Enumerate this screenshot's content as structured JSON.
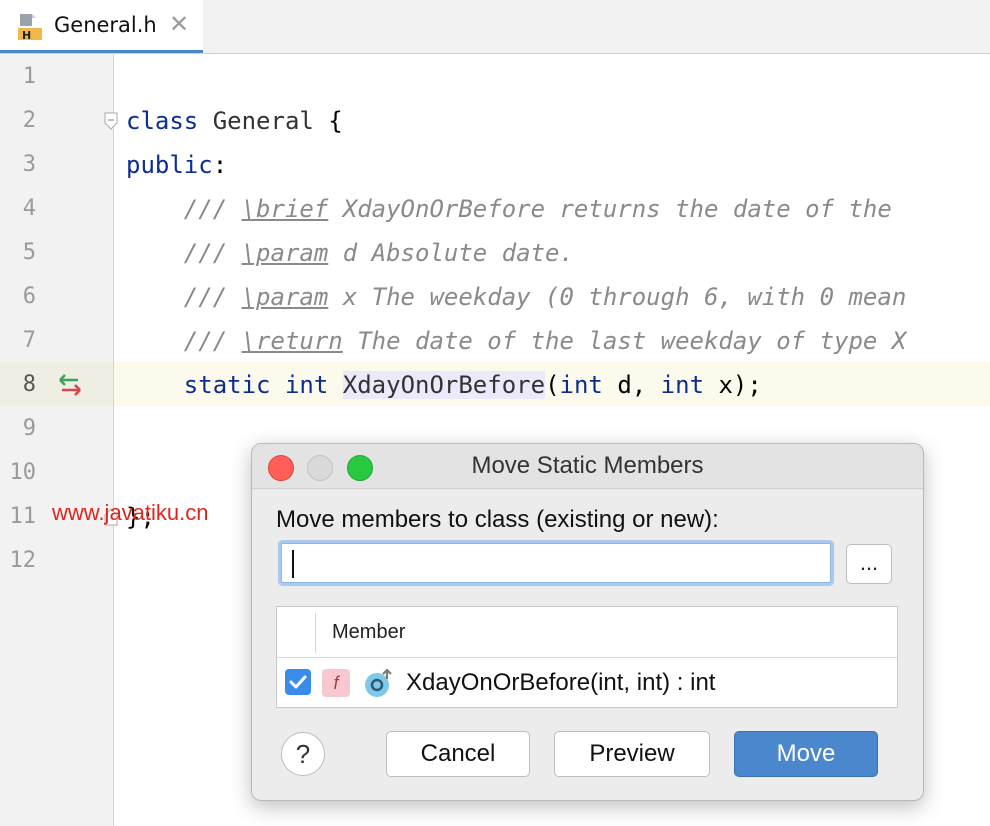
{
  "editor": {
    "tab": {
      "title": "General.h",
      "icon": "h-header-file-icon",
      "close_glyph": "✕"
    },
    "line_numbers": [
      "1",
      "2",
      "3",
      "4",
      "5",
      "6",
      "7",
      "8",
      "9",
      "10",
      "11",
      "12"
    ],
    "lines": {
      "l2_kw": "class",
      "l2_name": " General ",
      "l2_brace": "{",
      "l3_kw": "public",
      "l3_colon": ":",
      "l4_prefix": "    /// ",
      "l4_tag": "\\brief",
      "l4_text": " XdayOnOrBefore returns the date of the",
      "l5_prefix": "    /// ",
      "l5_tag": "\\param",
      "l5_text": " d Absolute date.",
      "l6_prefix": "    /// ",
      "l6_tag": "\\param",
      "l6_text": " x The weekday (0 through 6, with 0 mean",
      "l7_prefix": "    /// ",
      "l7_tag": "\\return",
      "l7_text": " The date of the last weekday of type X",
      "l8_indent": "    ",
      "l8_kw1": "static",
      "l8_sp1": " ",
      "l8_kw2": "int",
      "l8_sp2": " ",
      "l8_name": "XdayOnOrBefore",
      "l8_paren": "(",
      "l8_kw3": "int",
      "l8_arg1": " d, ",
      "l8_kw4": "int",
      "l8_arg2": " x);",
      "l11": "};"
    },
    "watermark": "www.javatiku.cn"
  },
  "dialog": {
    "title": "Move Static Members",
    "label": "Move members to class (existing or new):",
    "input_value": "",
    "browse_label": "...",
    "table": {
      "header": "Member",
      "rows": [
        {
          "checked": true,
          "visibility_badge": "f",
          "text": "XdayOnOrBefore(int, int) : int"
        }
      ]
    },
    "help_label": "?",
    "buttons": {
      "cancel": "Cancel",
      "preview": "Preview",
      "move": "Move"
    }
  },
  "colors": {
    "keyword": "#0c2d91",
    "comment": "#8a8a8a",
    "accent": "#4a87cd",
    "traffic_red": "#ff5f57",
    "traffic_gray": "#d9d9d9",
    "traffic_green": "#28c840"
  }
}
